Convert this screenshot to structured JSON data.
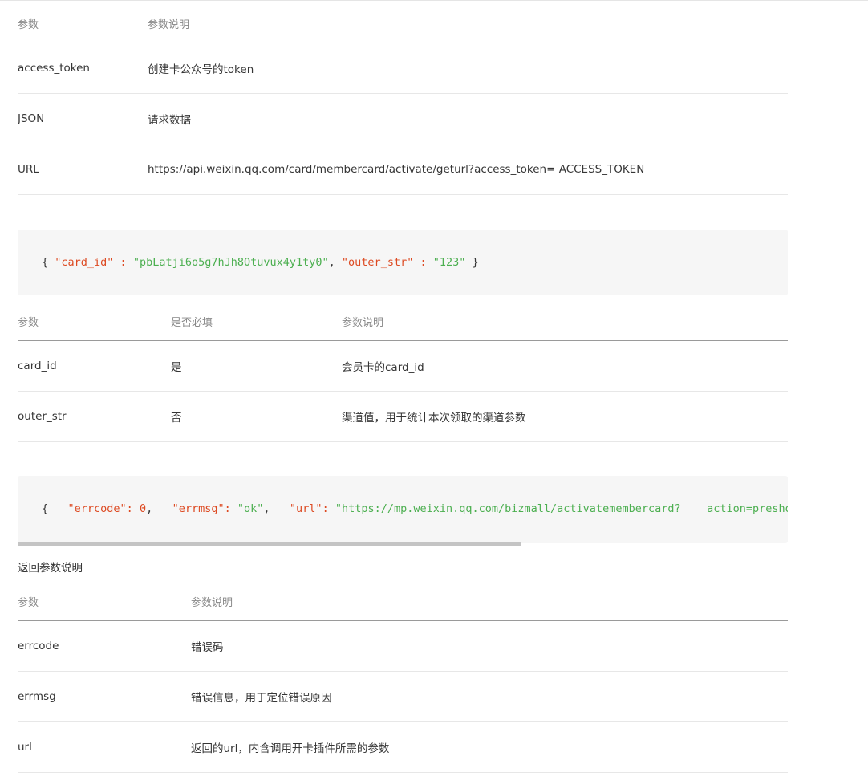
{
  "request_params": {
    "headers": [
      "参数",
      "参数说明"
    ],
    "rows": [
      [
        "access_token",
        "创建卡公众号的token"
      ],
      [
        "JSON",
        "请求数据"
      ],
      [
        "URL",
        "https://api.weixin.qq.com/card/membercard/activate/geturl?access_token= ACCESS_TOKEN"
      ]
    ]
  },
  "request_example": {
    "open": "{ ",
    "k1": "\"card_id\"",
    "sep1": " : ",
    "v1": "\"pbLatji6o5g7hJh8Otuvux4y1ty0\"",
    "comma1": ", ",
    "k2": "\"outer_str\"",
    "sep2": " : ",
    "v2": "\"123\"",
    "close": " }"
  },
  "body_params": {
    "headers": [
      "参数",
      "是否必填",
      "参数说明"
    ],
    "rows": [
      [
        "card_id",
        "是",
        "会员卡的card_id"
      ],
      [
        "outer_str",
        "否",
        "渠道值，用于统计本次领取的渠道参数"
      ]
    ]
  },
  "response_example": {
    "open": "{   ",
    "k1": "\"errcode\"",
    "sep1": ": ",
    "v1": "0",
    "comma1": ",   ",
    "k2": "\"errmsg\"",
    "sep2": ": ",
    "v2": "\"ok\"",
    "comma2": ",   ",
    "k3": "\"url\"",
    "sep3": ": ",
    "v3": "\"https://mp.weixin.qq.com/bizmall/activatemembercard?    action=preshow"
  },
  "return_label": "返回参数说明",
  "return_params": {
    "headers": [
      "参数",
      "参数说明"
    ],
    "rows": [
      [
        "errcode",
        "错误码"
      ],
      [
        "errmsg",
        "错误信息，用于定位错误原因"
      ],
      [
        "url",
        "返回的url，内含调用开卡插件所需的参数"
      ]
    ]
  }
}
